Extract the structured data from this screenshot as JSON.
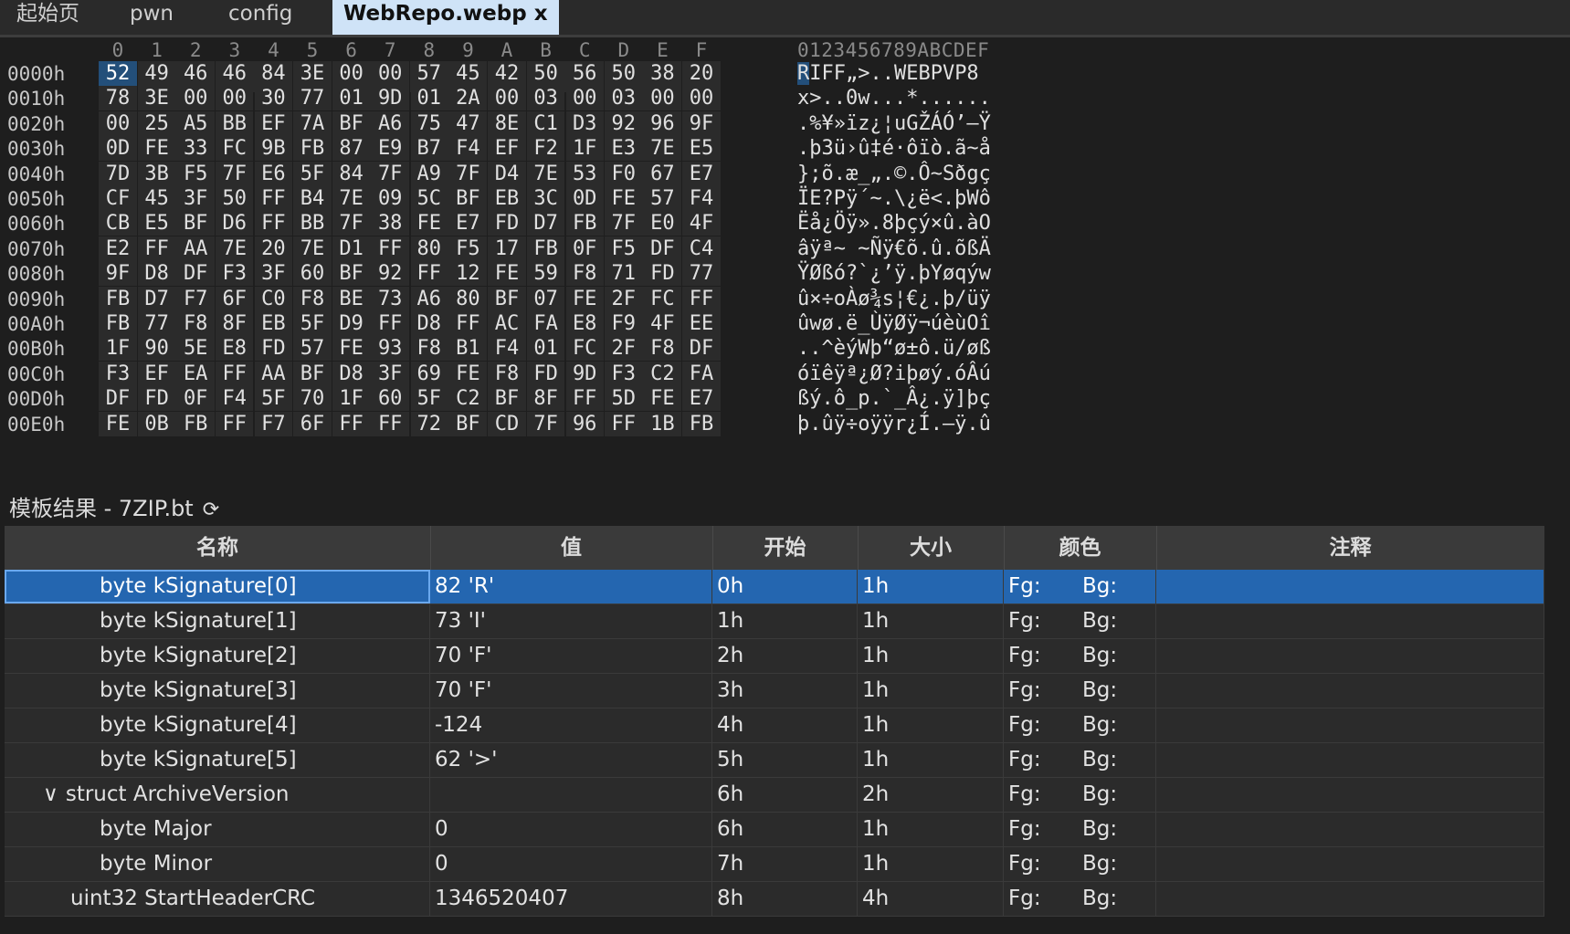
{
  "tabs": [
    {
      "label": "起始页"
    },
    {
      "label": "pwn"
    },
    {
      "label": "config"
    },
    {
      "label": "WebRepo.webp",
      "close": "x"
    }
  ],
  "hex": {
    "columns": [
      "0",
      "1",
      "2",
      "3",
      "4",
      "5",
      "6",
      "7",
      "8",
      "9",
      "A",
      "B",
      "C",
      "D",
      "E",
      "F"
    ],
    "ascii_header": "0123456789ABCDEF",
    "rows": [
      {
        "offset": "0000h",
        "bytes": [
          "52",
          "49",
          "46",
          "46",
          "84",
          "3E",
          "00",
          "00",
          "57",
          "45",
          "42",
          "50",
          "56",
          "50",
          "38",
          "20"
        ],
        "ascii": "RIFF„>..WEBPVP8 "
      },
      {
        "offset": "0010h",
        "bytes": [
          "78",
          "3E",
          "00",
          "00",
          "30",
          "77",
          "01",
          "9D",
          "01",
          "2A",
          "00",
          "03",
          "00",
          "03",
          "00",
          "00"
        ],
        "ascii": "x>..0w...*......"
      },
      {
        "offset": "0020h",
        "bytes": [
          "00",
          "25",
          "A5",
          "BB",
          "EF",
          "7A",
          "BF",
          "A6",
          "75",
          "47",
          "8E",
          "C1",
          "D3",
          "92",
          "96",
          "9F"
        ],
        "ascii": ".%¥»ïz¿¦uGŽÁÓ’–Ÿ"
      },
      {
        "offset": "0030h",
        "bytes": [
          "0D",
          "FE",
          "33",
          "FC",
          "9B",
          "FB",
          "87",
          "E9",
          "B7",
          "F4",
          "EF",
          "F2",
          "1F",
          "E3",
          "7E",
          "E5"
        ],
        "ascii": ".þ3ü›û‡é·ôïò.ã~å"
      },
      {
        "offset": "0040h",
        "bytes": [
          "7D",
          "3B",
          "F5",
          "7F",
          "E6",
          "5F",
          "84",
          "7F",
          "A9",
          "7F",
          "D4",
          "7E",
          "53",
          "F0",
          "67",
          "E7"
        ],
        "ascii": "};õ.æ_„.©.Ô~Sðgç"
      },
      {
        "offset": "0050h",
        "bytes": [
          "CF",
          "45",
          "3F",
          "50",
          "FF",
          "B4",
          "7E",
          "09",
          "5C",
          "BF",
          "EB",
          "3C",
          "0D",
          "FE",
          "57",
          "F4"
        ],
        "ascii": "ÏE?Pÿ´~.\\¿ë<.þWô"
      },
      {
        "offset": "0060h",
        "bytes": [
          "CB",
          "E5",
          "BF",
          "D6",
          "FF",
          "BB",
          "7F",
          "38",
          "FE",
          "E7",
          "FD",
          "D7",
          "FB",
          "7F",
          "E0",
          "4F"
        ],
        "ascii": "Ëå¿Öÿ».8þçý×û.àO"
      },
      {
        "offset": "0070h",
        "bytes": [
          "E2",
          "FF",
          "AA",
          "7E",
          "20",
          "7E",
          "D1",
          "FF",
          "80",
          "F5",
          "17",
          "FB",
          "0F",
          "F5",
          "DF",
          "C4"
        ],
        "ascii": "âÿª~ ~Ñÿ€õ.û.õßÄ"
      },
      {
        "offset": "0080h",
        "bytes": [
          "9F",
          "D8",
          "DF",
          "F3",
          "3F",
          "60",
          "BF",
          "92",
          "FF",
          "12",
          "FE",
          "59",
          "F8",
          "71",
          "FD",
          "77"
        ],
        "ascii": "ŸØßó?`¿’ÿ.þYøqýw"
      },
      {
        "offset": "0090h",
        "bytes": [
          "FB",
          "D7",
          "F7",
          "6F",
          "C0",
          "F8",
          "BE",
          "73",
          "A6",
          "80",
          "BF",
          "07",
          "FE",
          "2F",
          "FC",
          "FF"
        ],
        "ascii": "û×÷oÀø¾s¦€¿.þ/üÿ"
      },
      {
        "offset": "00A0h",
        "bytes": [
          "FB",
          "77",
          "F8",
          "8F",
          "EB",
          "5F",
          "D9",
          "FF",
          "D8",
          "FF",
          "AC",
          "FA",
          "E8",
          "F9",
          "4F",
          "EE"
        ],
        "ascii": "ûwø.ë_ÙÿØÿ¬úèùOî"
      },
      {
        "offset": "00B0h",
        "bytes": [
          "1F",
          "90",
          "5E",
          "E8",
          "FD",
          "57",
          "FE",
          "93",
          "F8",
          "B1",
          "F4",
          "01",
          "FC",
          "2F",
          "F8",
          "DF"
        ],
        "ascii": "..^èýWþ“ø±ô.ü/øß"
      },
      {
        "offset": "00C0h",
        "bytes": [
          "F3",
          "EF",
          "EA",
          "FF",
          "AA",
          "BF",
          "D8",
          "3F",
          "69",
          "FE",
          "F8",
          "FD",
          "9D",
          "F3",
          "C2",
          "FA"
        ],
        "ascii": "óïêÿª¿Ø?iþøý.óÂú"
      },
      {
        "offset": "00D0h",
        "bytes": [
          "DF",
          "FD",
          "0F",
          "F4",
          "5F",
          "70",
          "1F",
          "60",
          "5F",
          "C2",
          "BF",
          "8F",
          "FF",
          "5D",
          "FE",
          "E7"
        ],
        "ascii": "ßý.ô_p.`_Â¿.ÿ]þç"
      },
      {
        "offset": "00E0h",
        "bytes": [
          "FE",
          "0B",
          "FB",
          "FF",
          "F7",
          "6F",
          "FF",
          "FF",
          "72",
          "BF",
          "CD",
          "7F",
          "96",
          "FF",
          "1B",
          "FB"
        ],
        "ascii": "þ.ûÿ÷oÿÿr¿Í.–ÿ.û"
      }
    ]
  },
  "template": {
    "title": "模板结果 - 7ZIP.bt",
    "refresh_icon": "refresh-icon",
    "headers": [
      "名称",
      "值",
      "开始",
      "大小",
      "颜色",
      "注释"
    ],
    "rows": [
      {
        "name": "byte kSignature[0]",
        "value": "82 'R'",
        "start": "0h",
        "size": "1h",
        "fg": "Fg:",
        "bg": "Bg:",
        "comment": "",
        "indent": 2,
        "selected": true
      },
      {
        "name": "byte kSignature[1]",
        "value": "73 'I'",
        "start": "1h",
        "size": "1h",
        "fg": "Fg:",
        "bg": "Bg:",
        "comment": "",
        "indent": 2
      },
      {
        "name": "byte kSignature[2]",
        "value": "70 'F'",
        "start": "2h",
        "size": "1h",
        "fg": "Fg:",
        "bg": "Bg:",
        "comment": "",
        "indent": 2
      },
      {
        "name": "byte kSignature[3]",
        "value": "70 'F'",
        "start": "3h",
        "size": "1h",
        "fg": "Fg:",
        "bg": "Bg:",
        "comment": "",
        "indent": 2
      },
      {
        "name": "byte kSignature[4]",
        "value": "-124",
        "start": "4h",
        "size": "1h",
        "fg": "Fg:",
        "bg": "Bg:",
        "comment": "",
        "indent": 2
      },
      {
        "name": "byte kSignature[5]",
        "value": "62 '>'",
        "start": "5h",
        "size": "1h",
        "fg": "Fg:",
        "bg": "Bg:",
        "comment": "",
        "indent": 2
      },
      {
        "name": "struct ArchiveVersion",
        "value": "",
        "start": "6h",
        "size": "2h",
        "fg": "Fg:",
        "bg": "Bg:",
        "comment": "",
        "indent": 1,
        "expander": "∨"
      },
      {
        "name": "byte Major",
        "value": "0",
        "start": "6h",
        "size": "1h",
        "fg": "Fg:",
        "bg": "Bg:",
        "comment": "",
        "indent": 2
      },
      {
        "name": "byte Minor",
        "value": "0",
        "start": "7h",
        "size": "1h",
        "fg": "Fg:",
        "bg": "Bg:",
        "comment": "",
        "indent": 2
      },
      {
        "name": "uint32 StartHeaderCRC",
        "value": "1346520407",
        "start": "8h",
        "size": "4h",
        "fg": "Fg:",
        "bg": "Bg:",
        "comment": "",
        "indent": 1
      }
    ]
  },
  "colors": {
    "selection": "#2466b0",
    "tab_active": "#cfe3f7"
  }
}
